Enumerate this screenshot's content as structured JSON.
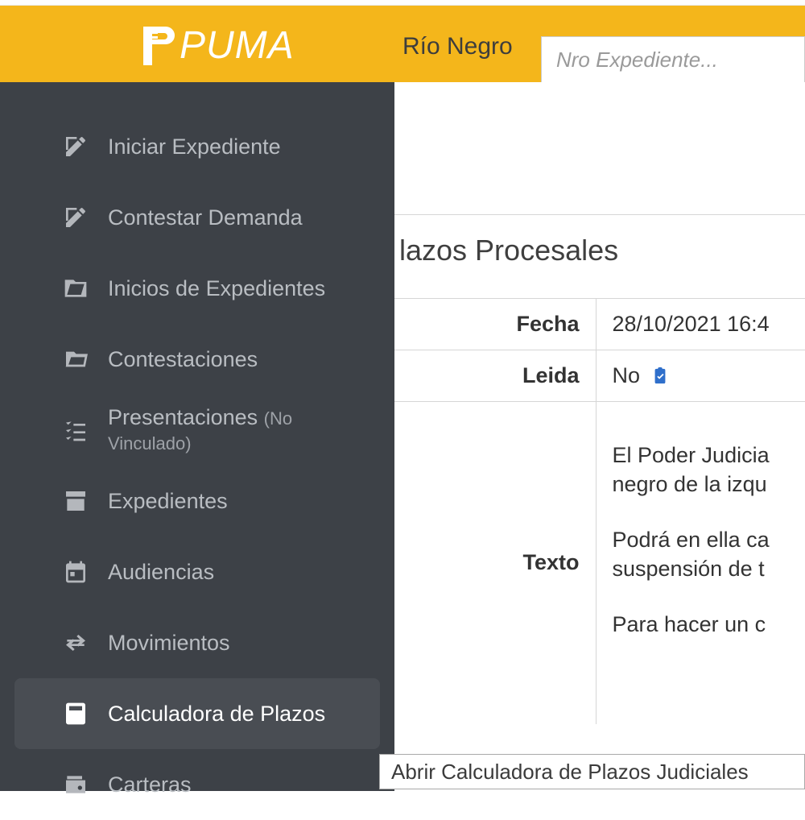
{
  "brand": {
    "name": "PUMA"
  },
  "region": "Río Negro",
  "search": {
    "placeholder": "Nro Expediente..."
  },
  "sidebar": {
    "items": [
      {
        "label": "Iniciar Expediente",
        "icon": "edit-square-icon",
        "active": false
      },
      {
        "label": "Contestar Demanda",
        "icon": "edit-square-icon",
        "active": false
      },
      {
        "label": "Inicios de Expedientes",
        "icon": "folder-open-icon",
        "active": false
      },
      {
        "label": "Contestaciones",
        "icon": "folder-open-outline-icon",
        "active": false
      },
      {
        "label": "Presentaciones",
        "note": "(No Vinculado)",
        "icon": "checklist-icon",
        "active": false
      },
      {
        "label": "Expedientes",
        "icon": "archive-box-icon",
        "active": false
      },
      {
        "label": "Audiencias",
        "icon": "calendar-icon",
        "active": false
      },
      {
        "label": "Movimientos",
        "icon": "transfer-icon",
        "active": false
      },
      {
        "label": "Calculadora de Plazos",
        "icon": "calculator-icon",
        "active": true
      },
      {
        "label": "Carteras",
        "icon": "wallet-icon",
        "active": false
      }
    ]
  },
  "panel": {
    "title_fragment": "lazos Procesales",
    "rows": {
      "fecha": {
        "label": "Fecha",
        "value": "28/10/2021 16:4"
      },
      "leida": {
        "label": "Leida",
        "value": "No"
      },
      "texto": {
        "label": "Texto",
        "paragraph1": "El Poder Judicia negro de la izqu",
        "paragraph2": "Podrá en ella ca suspensión de t",
        "paragraph3": "Para hacer un c"
      }
    }
  },
  "tooltip": "Abrir Calculadora de Plazos Judiciales"
}
